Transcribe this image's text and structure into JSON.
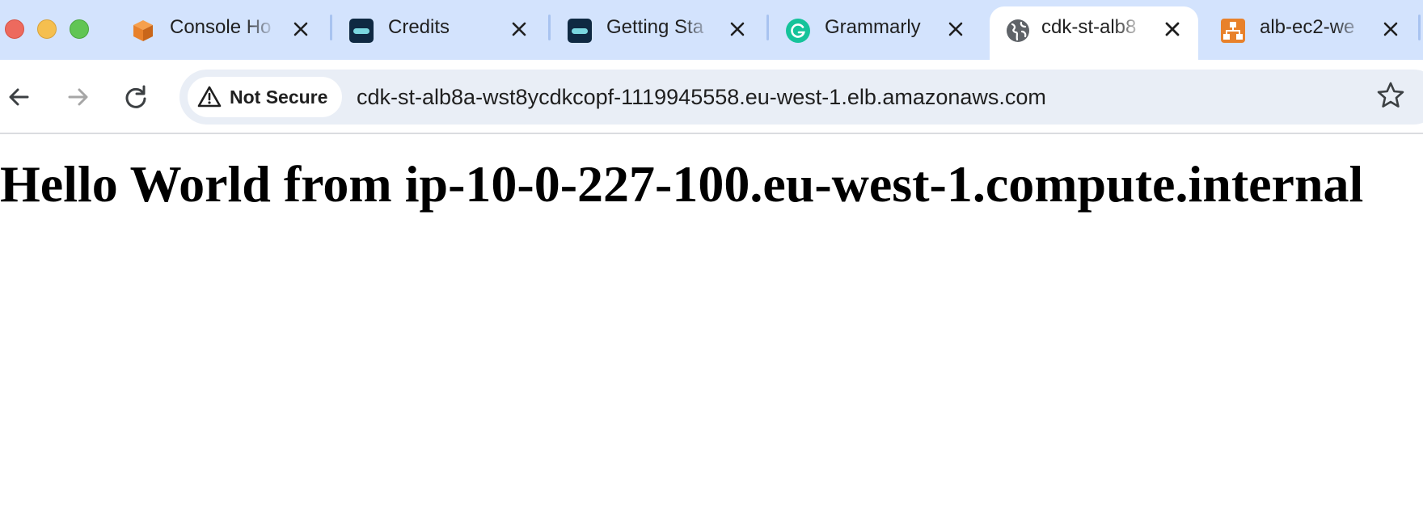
{
  "tabs": [
    {
      "title": "Console Ho",
      "icon": "aws-cube-icon"
    },
    {
      "title": "Credits",
      "icon": "credits-app-icon"
    },
    {
      "title": "Getting Sta",
      "icon": "credits-app-icon"
    },
    {
      "title": "Grammarly",
      "icon": "grammarly-icon"
    },
    {
      "title": "cdk-st-alb8",
      "icon": "globe-icon",
      "active": true
    },
    {
      "title": "alb-ec2-we",
      "icon": "diagram-app-icon"
    }
  ],
  "toolbar": {
    "security_label": "Not Secure",
    "url": "cdk-st-alb8a-wst8ycdkcopf-1119945558.eu-west-1.elb.amazonaws.com"
  },
  "page": {
    "heading": "Hello World from ip-10-0-227-100.eu-west-1.compute.internal"
  },
  "colors": {
    "tabstrip_bg": "#d3e3fd",
    "omnibox_bg": "#e9eef6",
    "aws_orange": "#e8812b",
    "grammarly_green": "#15c39a"
  }
}
